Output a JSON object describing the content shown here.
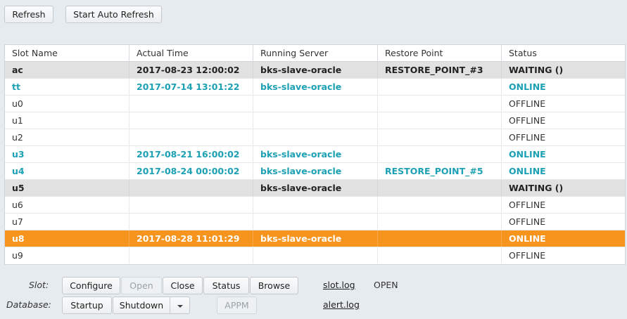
{
  "toolbar": {
    "refresh_label": "Refresh",
    "auto_refresh_label": "Start Auto Refresh"
  },
  "table": {
    "headers": [
      "Slot Name",
      "Actual Time",
      "Running Server",
      "Restore Point",
      "Status"
    ],
    "rows": [
      {
        "slot": "ac",
        "time": "2017-08-23 12:00:02",
        "server": "bks-slave-oracle",
        "restore": "RESTORE_POINT_#3",
        "status": "WAITING ()",
        "state": "waiting"
      },
      {
        "slot": "tt",
        "time": "2017-07-14 13:01:22",
        "server": "bks-slave-oracle",
        "restore": "",
        "status": "ONLINE",
        "state": "online"
      },
      {
        "slot": "u0",
        "time": "",
        "server": "",
        "restore": "",
        "status": "OFFLINE",
        "state": "offline"
      },
      {
        "slot": "u1",
        "time": "",
        "server": "",
        "restore": "",
        "status": "OFFLINE",
        "state": "offline"
      },
      {
        "slot": "u2",
        "time": "",
        "server": "",
        "restore": "",
        "status": "OFFLINE",
        "state": "offline"
      },
      {
        "slot": "u3",
        "time": "2017-08-21 16:00:02",
        "server": "bks-slave-oracle",
        "restore": "",
        "status": "ONLINE",
        "state": "online"
      },
      {
        "slot": "u4",
        "time": "2017-08-24 00:00:02",
        "server": "bks-slave-oracle",
        "restore": "RESTORE_POINT_#5",
        "status": "ONLINE",
        "state": "online"
      },
      {
        "slot": "u5",
        "time": "",
        "server": "bks-slave-oracle",
        "restore": "",
        "status": "WAITING ()",
        "state": "waiting"
      },
      {
        "slot": "u6",
        "time": "",
        "server": "",
        "restore": "",
        "status": "OFFLINE",
        "state": "offline"
      },
      {
        "slot": "u7",
        "time": "",
        "server": "",
        "restore": "",
        "status": "OFFLINE",
        "state": "offline"
      },
      {
        "slot": "u8",
        "time": "2017-08-28 11:01:29",
        "server": "bks-slave-oracle",
        "restore": "",
        "status": "ONLINE",
        "state": "selected"
      },
      {
        "slot": "u9",
        "time": "",
        "server": "",
        "restore": "",
        "status": "OFFLINE",
        "state": "offline"
      }
    ]
  },
  "slot_bar": {
    "label": "Slot:",
    "configure": "Configure",
    "open": "Open",
    "close": "Close",
    "status": "Status",
    "browse": "Browse",
    "log_link": "slot.log",
    "state": "OPEN"
  },
  "database_bar": {
    "label": "Database:",
    "startup": "Startup",
    "shutdown": "Shutdown",
    "appm": "APPM",
    "log_link": "alert.log"
  },
  "colors": {
    "online": "#1ba0b4",
    "selected_row": "#f7941d",
    "waiting_row": "#e1e1e1"
  }
}
